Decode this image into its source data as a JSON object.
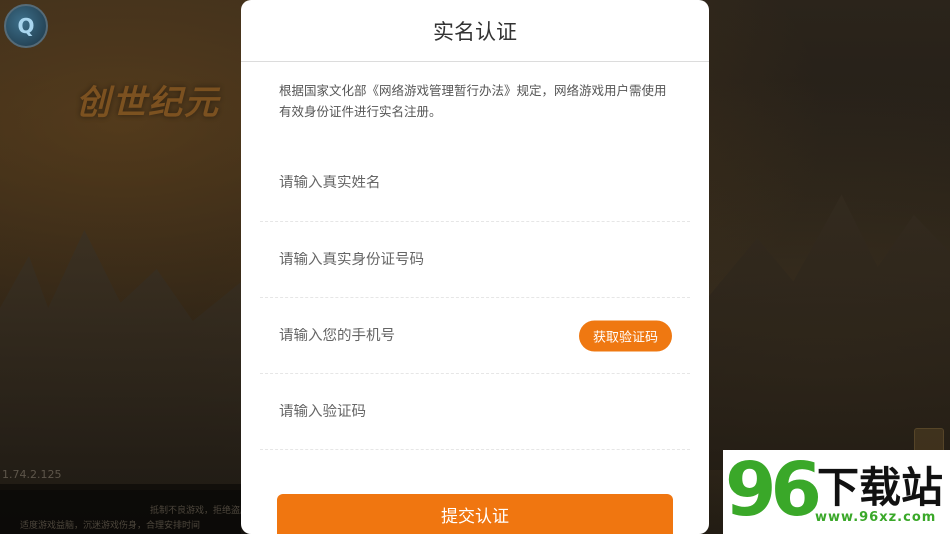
{
  "background": {
    "game_logo": "创世纪元",
    "version": "1.74.2.125",
    "footer_line1": "抵制不良游戏，拒绝盗版游戏",
    "footer_line2": "适度游戏益脑，沉迷游戏伤身，合理安排时间"
  },
  "dialog": {
    "title": "实名认证",
    "notice": "根据国家文化部《网络游戏管理暂行办法》规定，网络游戏用户需使用有效身份证件进行实名注册。",
    "fields": {
      "name_placeholder": "请输入真实姓名",
      "id_placeholder": "请输入真实身份证号码",
      "phone_placeholder": "请输入您的手机号",
      "code_placeholder": "请输入验证码"
    },
    "get_code_label": "获取验证码",
    "submit_label": "提交认证"
  },
  "watermark": {
    "number": "96",
    "text": "下载站",
    "url": "www.96xz.com"
  },
  "colors": {
    "accent": "#f07610",
    "watermark_green": "#3aa829"
  }
}
